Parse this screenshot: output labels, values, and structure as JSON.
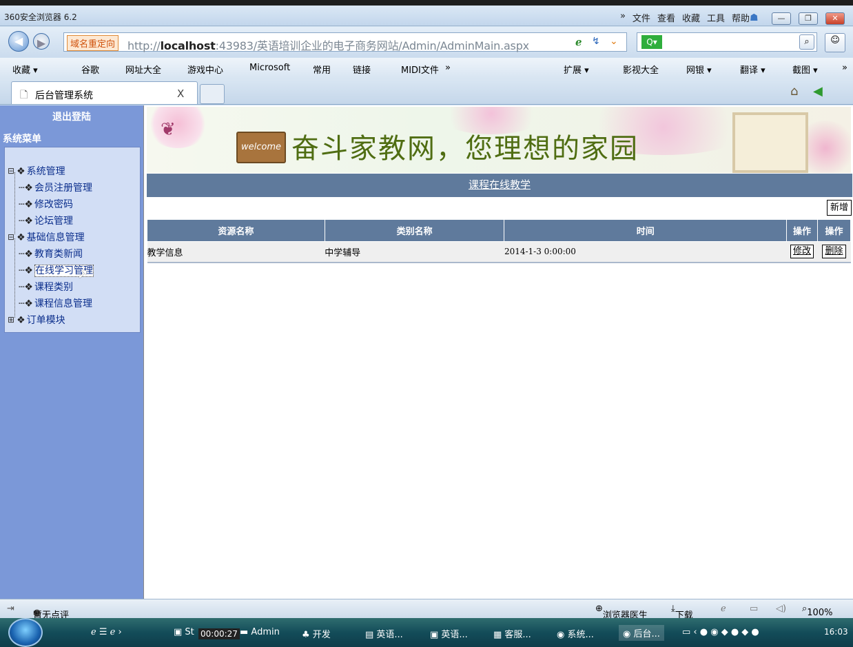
{
  "window": {
    "title": "360安全浏览器 6.2",
    "menu": [
      "»",
      "文件",
      "查看",
      "收藏",
      "工具",
      "帮助"
    ]
  },
  "address": {
    "redirect_label": "域名重定向",
    "url_prefix": "http://",
    "url_host": "localhost",
    "url_rest": ":43983/英语培训企业的电子商务网站/Admin/AdminMain.aspx"
  },
  "favbar": {
    "items": [
      "收藏 ▾",
      "谷歌",
      "网址大全",
      "游戏中心",
      "Microsoft",
      "常用",
      "链接",
      "MIDI文件",
      "»"
    ],
    "right_items": [
      "扩展 ▾",
      "影视大全",
      "网银 ▾",
      "翻译 ▾",
      "截图 ▾",
      "»"
    ]
  },
  "tab": {
    "label": "后台管理系统",
    "close": "X"
  },
  "sidebar": {
    "logout": "退出登陆",
    "menu_title": "系统菜单",
    "groups": [
      {
        "label": "系统管理",
        "expander": "⊟",
        "items": [
          "会员注册管理",
          "修改密码",
          "论坛管理"
        ]
      },
      {
        "label": "基础信息管理",
        "expander": "⊟",
        "items": [
          "教育类新闻",
          "在线学习管理",
          "课程类别",
          "课程信息管理"
        ]
      },
      {
        "label": "订单模块",
        "expander": "⊞",
        "items": []
      }
    ]
  },
  "banner": {
    "text": "奋斗家教网，您理想的家园",
    "welcome": "welcome"
  },
  "page": {
    "heading": "课程在线教学",
    "add_label": "新增"
  },
  "table": {
    "headers": [
      "资源名称",
      "类别名称",
      "时间",
      "操作",
      "操作"
    ],
    "rows": [
      {
        "name": "教学信息",
        "category": "中学辅导",
        "time": "2014-1-3 0:00:00",
        "edit": "修改",
        "delete": "删除"
      }
    ]
  },
  "status": {
    "left": "暂无点评",
    "doctor": "浏览器医生",
    "download": "下载",
    "zoom": "100%"
  },
  "taskbar": {
    "items": [
      "St",
      "Admin",
      "开发",
      "英语...",
      "英语...",
      "客服...",
      "系统...",
      "后台..."
    ],
    "timer": "00:00:27",
    "clock": "16:03"
  },
  "colors": {
    "sidebar_bg": "#7b98d8",
    "header_bg": "#5f7a9c",
    "tree_bg": "#d2def5"
  }
}
